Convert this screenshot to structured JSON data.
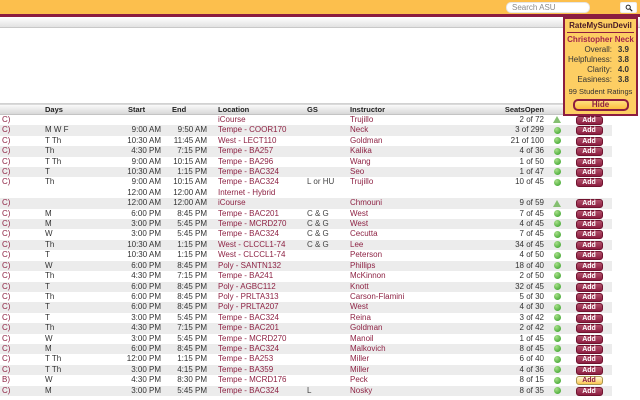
{
  "topbar": {
    "search_placeholder": "Search ASU"
  },
  "popup": {
    "title": "RateMySunDevil",
    "instructor_name": "Christopher Neck",
    "ratings": [
      {
        "label": "Overall:",
        "value": "3.9"
      },
      {
        "label": "Helpfulness:",
        "value": "3.8"
      },
      {
        "label": "Clarity:",
        "value": "4.0"
      },
      {
        "label": "Easiness:",
        "value": "3.8"
      }
    ],
    "ratings_count": "99 Student Ratings",
    "hide_label": "Hide"
  },
  "table": {
    "headers": {
      "course": "",
      "days": "Days",
      "start": "Start",
      "end": "End",
      "location": "Location",
      "gs": "GS",
      "instructor": "Instructor",
      "seats": "SeatsOpen"
    },
    "add_label": "Add",
    "rows": [
      {
        "course": "C)",
        "days": "",
        "start": "",
        "end": "",
        "location": "iCourse",
        "gs": "",
        "instructor": "Trujillo",
        "seats": "2 of 72",
        "status": "triangle",
        "add_highlight": false
      },
      {
        "course": "C)",
        "days": "M W F",
        "start": "9:00 AM",
        "end": "9:50 AM",
        "location": "Tempe - COOR170",
        "gs": "",
        "instructor": "Neck",
        "seats": "3 of 299",
        "status": "circle",
        "add_highlight": false
      },
      {
        "course": "C)",
        "days": "T Th",
        "start": "10:30 AM",
        "end": "11:45 AM",
        "location": "West - LECT110",
        "gs": "",
        "instructor": "Goldman",
        "seats": "21 of 100",
        "status": "circle",
        "add_highlight": false
      },
      {
        "course": "C)",
        "days": "Th",
        "start": "4:30 PM",
        "end": "7:15 PM",
        "location": "Tempe - BA257",
        "gs": "",
        "instructor": "Kalika",
        "seats": "4 of 36",
        "status": "circle",
        "add_highlight": false
      },
      {
        "course": "C)",
        "days": "T Th",
        "start": "9:00 AM",
        "end": "10:15 AM",
        "location": "Tempe - BA296",
        "gs": "",
        "instructor": "Wang",
        "seats": "1 of 50",
        "status": "circle",
        "add_highlight": false
      },
      {
        "course": "C)",
        "days": "T",
        "start": "10:30 AM",
        "end": "1:15 PM",
        "location": "Tempe - BAC324",
        "gs": "",
        "instructor": "Seo",
        "seats": "1 of 47",
        "status": "circle",
        "add_highlight": false
      },
      {
        "course": "C)",
        "days": "Th",
        "start": "9:00 AM",
        "end": "10:15 AM",
        "location": "Tempe - BAC324",
        "gs": "L or HU",
        "instructor": "Trujillo",
        "seats": "10 of 45",
        "status": "circle",
        "add_highlight": false,
        "line2": {
          "start": "12:00 AM",
          "end": "12:00 AM",
          "location": "Internet - Hybrid"
        }
      },
      {
        "course": "C)",
        "days": "",
        "start": "12:00 AM",
        "end": "12:00 AM",
        "location": "iCourse",
        "gs": "",
        "instructor": "Chmouni",
        "seats": "9 of 59",
        "status": "triangle",
        "add_highlight": false
      },
      {
        "course": "C)",
        "days": "M",
        "start": "6:00 PM",
        "end": "8:45 PM",
        "location": "Tempe - BAC201",
        "gs": "C & G",
        "instructor": "West",
        "seats": "7 of 45",
        "status": "circle",
        "add_highlight": false
      },
      {
        "course": "C)",
        "days": "M",
        "start": "3:00 PM",
        "end": "5:45 PM",
        "location": "Tempe - MCRD270",
        "gs": "C & G",
        "instructor": "West",
        "seats": "4 of 45",
        "status": "circle",
        "add_highlight": false
      },
      {
        "course": "C)",
        "days": "W",
        "start": "3:00 PM",
        "end": "5:45 PM",
        "location": "Tempe - BAC324",
        "gs": "C & G",
        "instructor": "Cecutta",
        "seats": "7 of 45",
        "status": "circle",
        "add_highlight": false
      },
      {
        "course": "C)",
        "days": "Th",
        "start": "10:30 AM",
        "end": "1:15 PM",
        "location": "West - CLCCL1-74",
        "gs": "C & G",
        "instructor": "Lee",
        "seats": "34 of 45",
        "status": "circle",
        "add_highlight": false
      },
      {
        "course": "C)",
        "days": "T",
        "start": "10:30 AM",
        "end": "1:15 PM",
        "location": "West - CLCCL1-74",
        "gs": "",
        "instructor": "Peterson",
        "seats": "4 of 50",
        "status": "circle",
        "add_highlight": false
      },
      {
        "course": "C)",
        "days": "W",
        "start": "6:00 PM",
        "end": "8:45 PM",
        "location": "Poly - SANTN132",
        "gs": "",
        "instructor": "Phillips",
        "seats": "18 of 40",
        "status": "circle",
        "add_highlight": false
      },
      {
        "course": "C)",
        "days": "Th",
        "start": "4:30 PM",
        "end": "7:15 PM",
        "location": "Tempe - BA241",
        "gs": "",
        "instructor": "McKinnon",
        "seats": "2 of 50",
        "status": "circle",
        "add_highlight": false
      },
      {
        "course": "C)",
        "days": "T",
        "start": "6:00 PM",
        "end": "8:45 PM",
        "location": "Poly - AGBC112",
        "gs": "",
        "instructor": "Knott",
        "seats": "32 of 45",
        "status": "circle",
        "add_highlight": false
      },
      {
        "course": "C)",
        "days": "Th",
        "start": "6:00 PM",
        "end": "8:45 PM",
        "location": "Poly - PRLTA313",
        "gs": "",
        "instructor": "Carson-Flamini",
        "seats": "5 of 30",
        "status": "circle",
        "add_highlight": false
      },
      {
        "course": "C)",
        "days": "T",
        "start": "6:00 PM",
        "end": "8:45 PM",
        "location": "Poly - PRLTA207",
        "gs": "",
        "instructor": "West",
        "seats": "4 of 30",
        "status": "circle",
        "add_highlight": false
      },
      {
        "course": "C)",
        "days": "T",
        "start": "3:00 PM",
        "end": "5:45 PM",
        "location": "Tempe - BAC324",
        "gs": "",
        "instructor": "Reina",
        "seats": "3 of 42",
        "status": "circle",
        "add_highlight": false
      },
      {
        "course": "C)",
        "days": "Th",
        "start": "4:30 PM",
        "end": "7:15 PM",
        "location": "Tempe - BAC201",
        "gs": "",
        "instructor": "Goldman",
        "seats": "2 of 42",
        "status": "circle",
        "add_highlight": false
      },
      {
        "course": "C)",
        "days": "W",
        "start": "3:00 PM",
        "end": "5:45 PM",
        "location": "Tempe - MCRD270",
        "gs": "",
        "instructor": "Manoil",
        "seats": "1 of 45",
        "status": "circle",
        "add_highlight": false
      },
      {
        "course": "C)",
        "days": "M",
        "start": "6:00 PM",
        "end": "8:45 PM",
        "location": "Tempe - BAC324",
        "gs": "",
        "instructor": "Malkovich",
        "seats": "8 of 45",
        "status": "circle",
        "add_highlight": false
      },
      {
        "course": "C)",
        "days": "T Th",
        "start": "12:00 PM",
        "end": "1:15 PM",
        "location": "Tempe - BA253",
        "gs": "",
        "instructor": "Miller",
        "seats": "6 of 40",
        "status": "circle",
        "add_highlight": false
      },
      {
        "course": "C)",
        "days": "T Th",
        "start": "3:00 PM",
        "end": "4:15 PM",
        "location": "Tempe - BA359",
        "gs": "",
        "instructor": "Miller",
        "seats": "4 of 36",
        "status": "circle",
        "add_highlight": false
      },
      {
        "course": "B)",
        "days": "W",
        "start": "4:30 PM",
        "end": "8:30 PM",
        "location": "Tempe - MCRD176",
        "gs": "",
        "instructor": "Peck",
        "seats": "8 of 15",
        "status": "circle",
        "add_highlight": true
      },
      {
        "course": "C)",
        "days": "M",
        "start": "3:00 PM",
        "end": "5:45 PM",
        "location": "Tempe - BAC324",
        "gs": "L",
        "instructor": "Nosky",
        "seats": "8 of 35",
        "status": "circle",
        "add_highlight": false
      }
    ]
  },
  "colors": {
    "asu_gold": "#fcbf4d",
    "asu_maroon": "#8c1d40",
    "popup_gold": "#fdce63",
    "link_maroon": "#8e2344",
    "seat_open_green": "#4fae3d",
    "row_alt_gray": "#ececec"
  }
}
